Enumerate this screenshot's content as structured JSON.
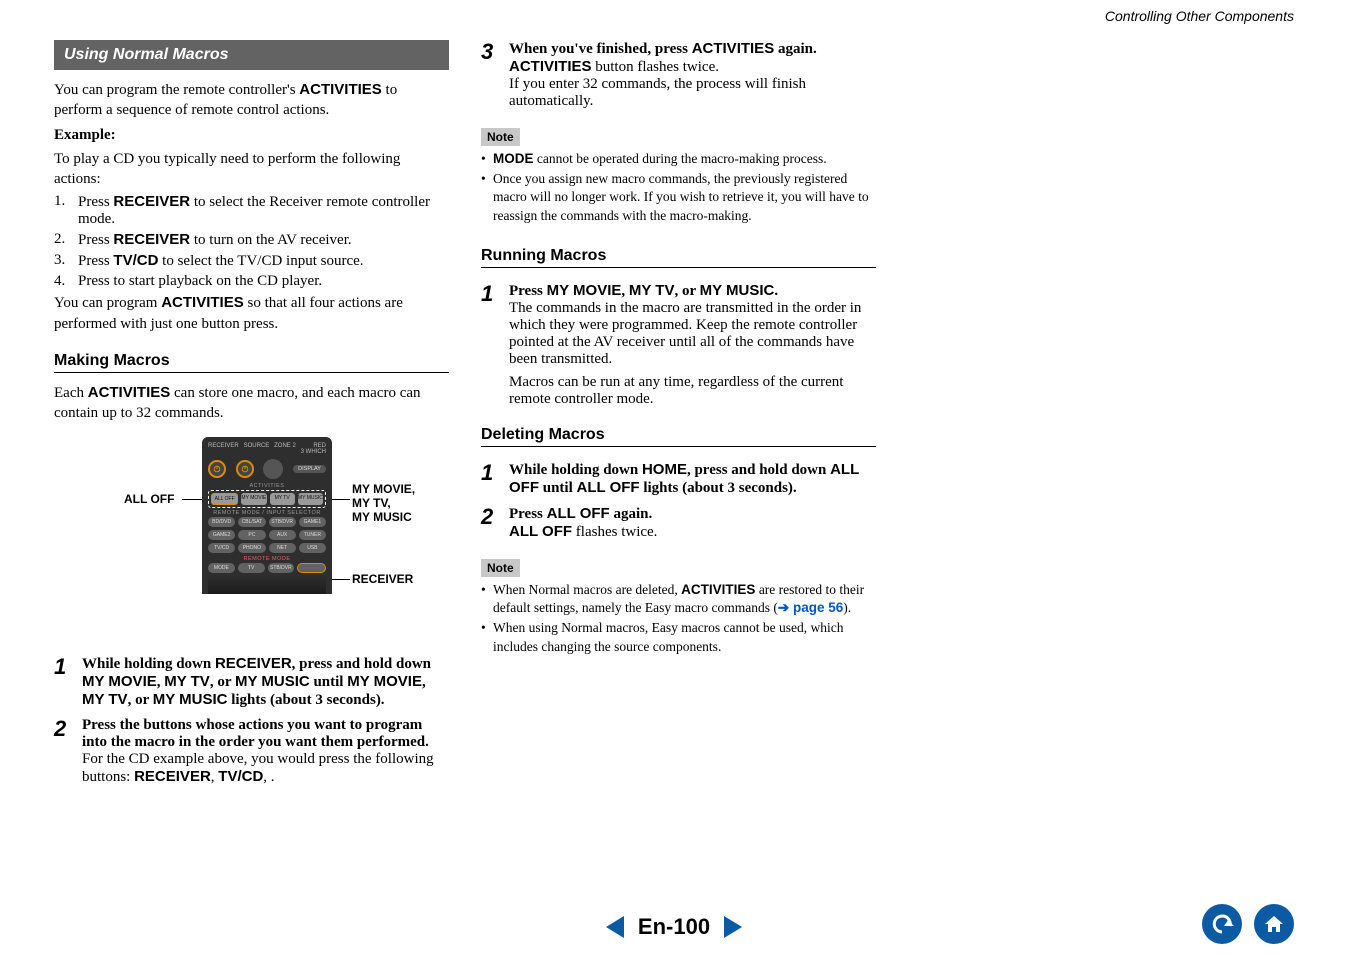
{
  "header": {
    "section_title": "Controlling Other Components"
  },
  "col1": {
    "banner": "Using Normal Macros",
    "intro1_a": "You can program the remote controller's ",
    "intro1_b": "ACTIVITIES",
    "intro1_c": " to perform a sequence of remote control actions.",
    "example_label": "Example:",
    "example_intro": "To play a CD you typically need to perform the following actions:",
    "list": [
      {
        "n": "1.",
        "pre": "Press ",
        "kw": "RECEIVER",
        "post": " to select the Receiver remote controller mode."
      },
      {
        "n": "2.",
        "pre": "Press    ",
        "kw": "RECEIVER",
        "post": " to turn on the AV receiver."
      },
      {
        "n": "3.",
        "pre": "Press ",
        "kw": "TV/CD",
        "post": " to select the TV/CD input source."
      },
      {
        "n": "4.",
        "pre": "Press       to start playback on the CD player.",
        "kw": "",
        "post": ""
      }
    ],
    "intro2_a": "You can program ",
    "intro2_b": "ACTIVITIES",
    "intro2_c": " so that all four actions are performed with just one button press.",
    "h_making": "Making Macros",
    "making_a": "Each ",
    "making_b": "ACTIVITIES",
    "making_c": " can store one macro, and each macro can contain up to 32 commands.",
    "figure": {
      "left_label": "ALL OFF",
      "right_label_top": "MY MOVIE,\nMY TV,\nMY MUSIC",
      "right_label_bottom": "RECEIVER",
      "remote_top": {
        "labels": [
          "RECEIVER",
          "SOURCE",
          "ZONE 2",
          "RED\n3 WHICH"
        ],
        "display": "DISPLAY"
      },
      "activities_label": "ACTIVITIES",
      "act_buttons": [
        "ALL OFF",
        "MY MOVIE",
        "MY TV",
        "MY MUSIC"
      ],
      "mode_label": "REMOTE MODE / INPUT SELECTOR",
      "grid_rows": [
        [
          "BD/DVD",
          "CBL/SAT",
          "STB/DVR",
          "GAME1"
        ],
        [
          "GAME2",
          "PC",
          "AUX",
          "TUNER"
        ],
        [
          "TV/CD",
          "PHONO",
          "NET",
          "USB"
        ]
      ],
      "remote_mode_label": "REMOTE MODE",
      "bottom_row": [
        "MODE",
        "TV",
        "STB/DVR",
        ""
      ]
    },
    "steps": [
      {
        "n": "1",
        "text_parts": [
          {
            "t": "While holding down ",
            "b": true
          },
          {
            "t": "RECEIVER",
            "sans": true
          },
          {
            "t": ", press and hold down ",
            "b": true
          },
          {
            "t": "MY MOVIE",
            "sans": true
          },
          {
            "t": ", ",
            "b": true
          },
          {
            "t": "MY TV",
            "sans": true
          },
          {
            "t": ", or ",
            "b": true
          },
          {
            "t": "MY MUSIC",
            "sans": true
          },
          {
            "t": " until ",
            "b": true
          },
          {
            "t": "MY MOVIE",
            "sans": true
          },
          {
            "t": ", ",
            "b": true
          },
          {
            "t": "MY TV",
            "sans": true
          },
          {
            "t": ", or ",
            "b": true
          },
          {
            "t": "MY MUSIC",
            "sans": true
          },
          {
            "t": " lights (about 3 seconds).",
            "b": true
          }
        ]
      },
      {
        "n": "2",
        "line1_bold": "Press the buttons whose actions you want to program into the macro in the order you want them performed.",
        "line2_a": "For the CD example above, you would press the following buttons:    ",
        "line2_kw1": "RECEIVER",
        "line2_sep": ", ",
        "line2_kw2": "TV/CD",
        "line2_end": ",       ."
      }
    ]
  },
  "col2": {
    "step3": {
      "n": "3",
      "l1_a": "When you've finished, press ",
      "l1_b": "ACTIVITIES",
      "l1_c": " again.",
      "l2_a": "ACTIVITIES",
      "l2_b": " button flashes twice.",
      "l3": "If you enter 32 commands, the process will finish automatically."
    },
    "note_label": "Note",
    "notes1": [
      {
        "parts": [
          {
            "sans": true,
            "t": "MODE"
          },
          {
            "t": " cannot be operated during the macro-making process."
          }
        ]
      },
      {
        "parts": [
          {
            "t": "Once you assign new macro commands, the previously registered macro will no longer work. If you wish to retrieve it, you will have to reassign the commands with the macro-making."
          }
        ]
      }
    ],
    "h_running": "Running Macros",
    "run_step": {
      "n": "1",
      "l1_a": "Press ",
      "l1_b": "MY MOVIE",
      "l1_c": ", ",
      "l1_d": "MY TV",
      "l1_e": ", or ",
      "l1_f": "MY MUSIC",
      "l1_g": ".",
      "l2": "The commands in the macro are transmitted in the order in which they were programmed. Keep the remote controller pointed at the AV receiver until all of the commands have been transmitted.",
      "l3": "Macros can be run at any time, regardless of the current remote controller mode."
    },
    "h_deleting": "Deleting Macros",
    "del_steps": [
      {
        "n": "1",
        "parts": [
          {
            "t": "While holding down ",
            "b": true
          },
          {
            "t": "HOME",
            "sans": true
          },
          {
            "t": ", press and hold down ",
            "b": true
          },
          {
            "t": "ALL OFF",
            "sans": true
          },
          {
            "t": " until ",
            "b": true
          },
          {
            "t": "ALL OFF",
            "sans": true
          },
          {
            "t": " lights (about 3 seconds).",
            "b": true
          }
        ]
      },
      {
        "n": "2",
        "l1_a": "Press ",
        "l1_b": "ALL OFF",
        "l1_c": " again.",
        "l2_a": "ALL OFF",
        "l2_b": " flashes twice."
      }
    ],
    "notes2": [
      {
        "parts": [
          {
            "t": "When Normal macros are deleted, "
          },
          {
            "sans": true,
            "t": "ACTIVITIES"
          },
          {
            "t": " are restored to their default settings, namely the Easy macro commands ("
          },
          {
            "arrow": true,
            "t": "➔ "
          },
          {
            "link": true,
            "t": "page 56"
          },
          {
            "t": ")."
          }
        ]
      },
      {
        "parts": [
          {
            "t": "When using Normal macros, Easy macros cannot be used, which includes changing the source components."
          }
        ]
      }
    ]
  },
  "footer": {
    "page_label": "En-100"
  }
}
